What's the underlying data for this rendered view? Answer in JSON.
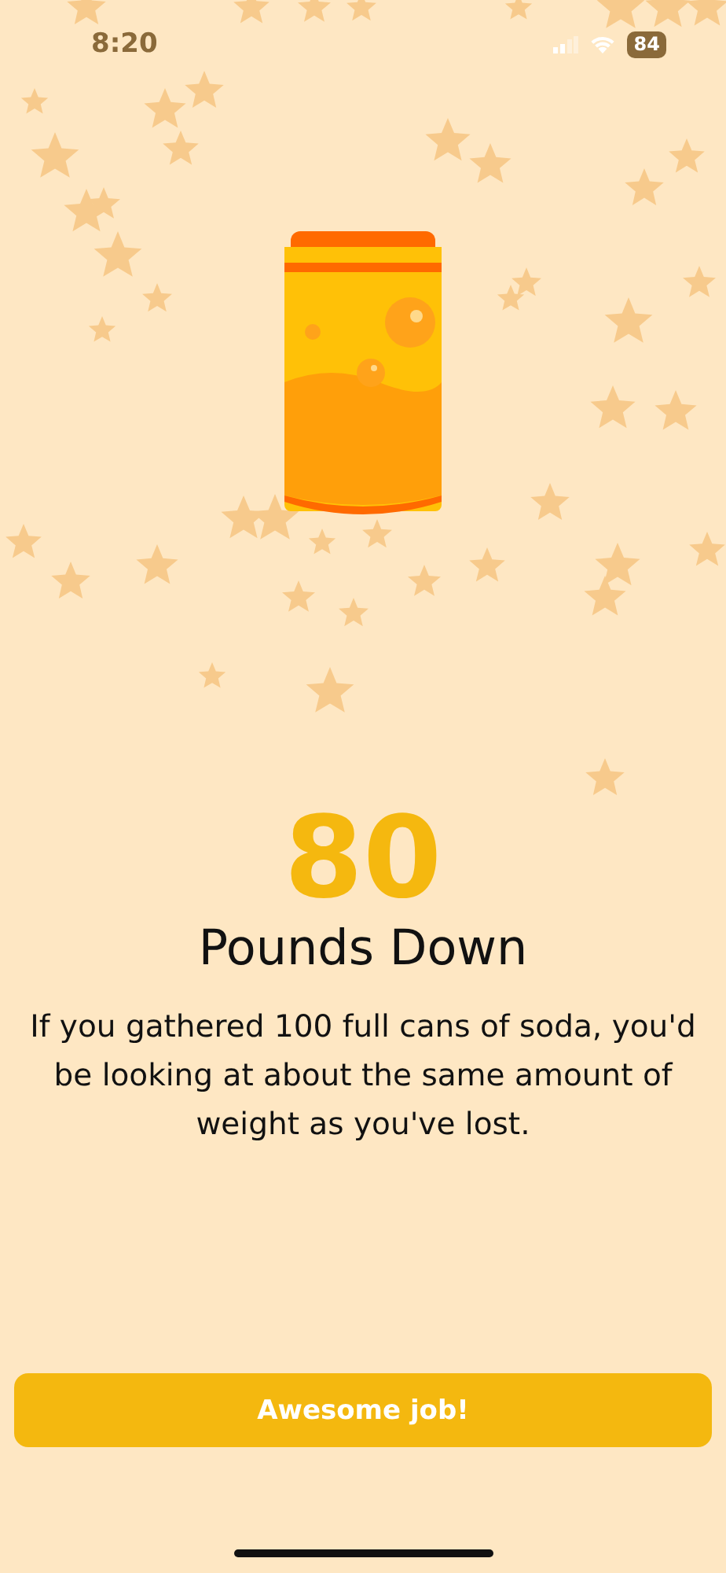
{
  "status_bar": {
    "time": "8:20",
    "battery": "84"
  },
  "result": {
    "number": "80",
    "title": "Pounds Down",
    "description": "If you gathered 100 full cans of soda, you'd be looking at about the same amount of weight as you've lost."
  },
  "button": {
    "label": "Awesome job!"
  }
}
